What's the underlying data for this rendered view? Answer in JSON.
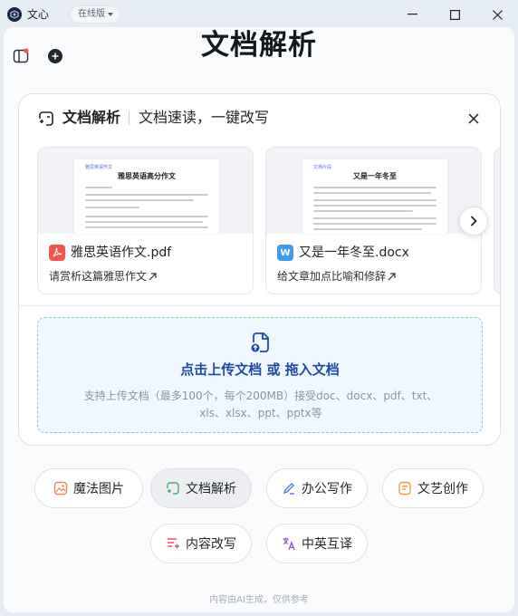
{
  "window": {
    "app_name": "文心",
    "version_label": "在线版"
  },
  "page": {
    "title": "文档解析"
  },
  "card": {
    "title": "文档解析",
    "subtitle": "文档速读，一键改写",
    "files": [
      {
        "name": "雅思英语作文.pdf",
        "type_icon": "pdf-icon",
        "desc": "请赏析这篇雅思作文",
        "preview_title": "雅思英语高分作文",
        "preview_header": "雅思英语作文"
      },
      {
        "name": "又是一年冬至.docx",
        "type_icon": "word-icon",
        "icon_letter": "W",
        "desc": "给文章加点比喻和修辞",
        "preview_title": "又是一年冬至",
        "preview_header": "文档片段"
      }
    ],
    "upload": {
      "title": "点击上传文档 或 拖入文档",
      "hint": "支持上传文档（最多100个，每个200MB）接受doc、docx、pdf、txt、xls、xlsx、ppt、pptx等"
    }
  },
  "chips": [
    {
      "label": "魔法图片",
      "icon": "image-icon",
      "color": "#e8875a"
    },
    {
      "label": "文档解析",
      "icon": "doc-parse-icon",
      "color": "#3db27a",
      "active": true
    },
    {
      "label": "办公写作",
      "icon": "pen-icon",
      "color": "#4a7bdc"
    },
    {
      "label": "文艺创作",
      "icon": "note-icon",
      "color": "#e9a23b"
    },
    {
      "label": "内容改写",
      "icon": "rewrite-icon",
      "color": "#e0566a"
    },
    {
      "label": "中英互译",
      "icon": "translate-icon",
      "color": "#8a57d1"
    }
  ],
  "footer": {
    "note": "内容由AI生成，仅供参考"
  },
  "colors": {
    "accent_blue": "#1d4aa8",
    "upload_border": "#8fc4dc",
    "pdf_red": "#f0564b",
    "word_blue": "#3f9bf0"
  }
}
